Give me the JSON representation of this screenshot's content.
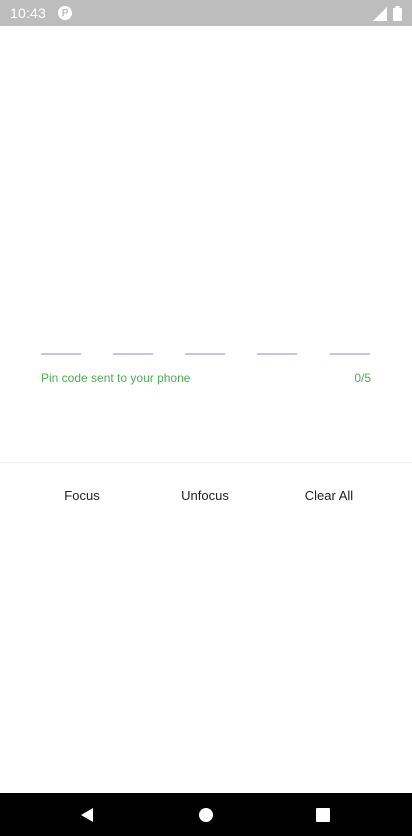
{
  "status_bar": {
    "time": "10:43",
    "app_icon_letter": "P",
    "icons": [
      "signal-icon",
      "battery-icon"
    ]
  },
  "pin": {
    "length": 5,
    "helper_text": "Pin code sent to your phone",
    "counter": "0/5",
    "helper_color": "#4caf50",
    "slot_color": "#c9c2ee"
  },
  "buttons": {
    "focus_label": "Focus",
    "unfocus_label": "Unfocus",
    "clear_label": "Clear All"
  },
  "nav_bar": {
    "icons": [
      "back-icon",
      "home-icon",
      "recents-icon"
    ]
  }
}
